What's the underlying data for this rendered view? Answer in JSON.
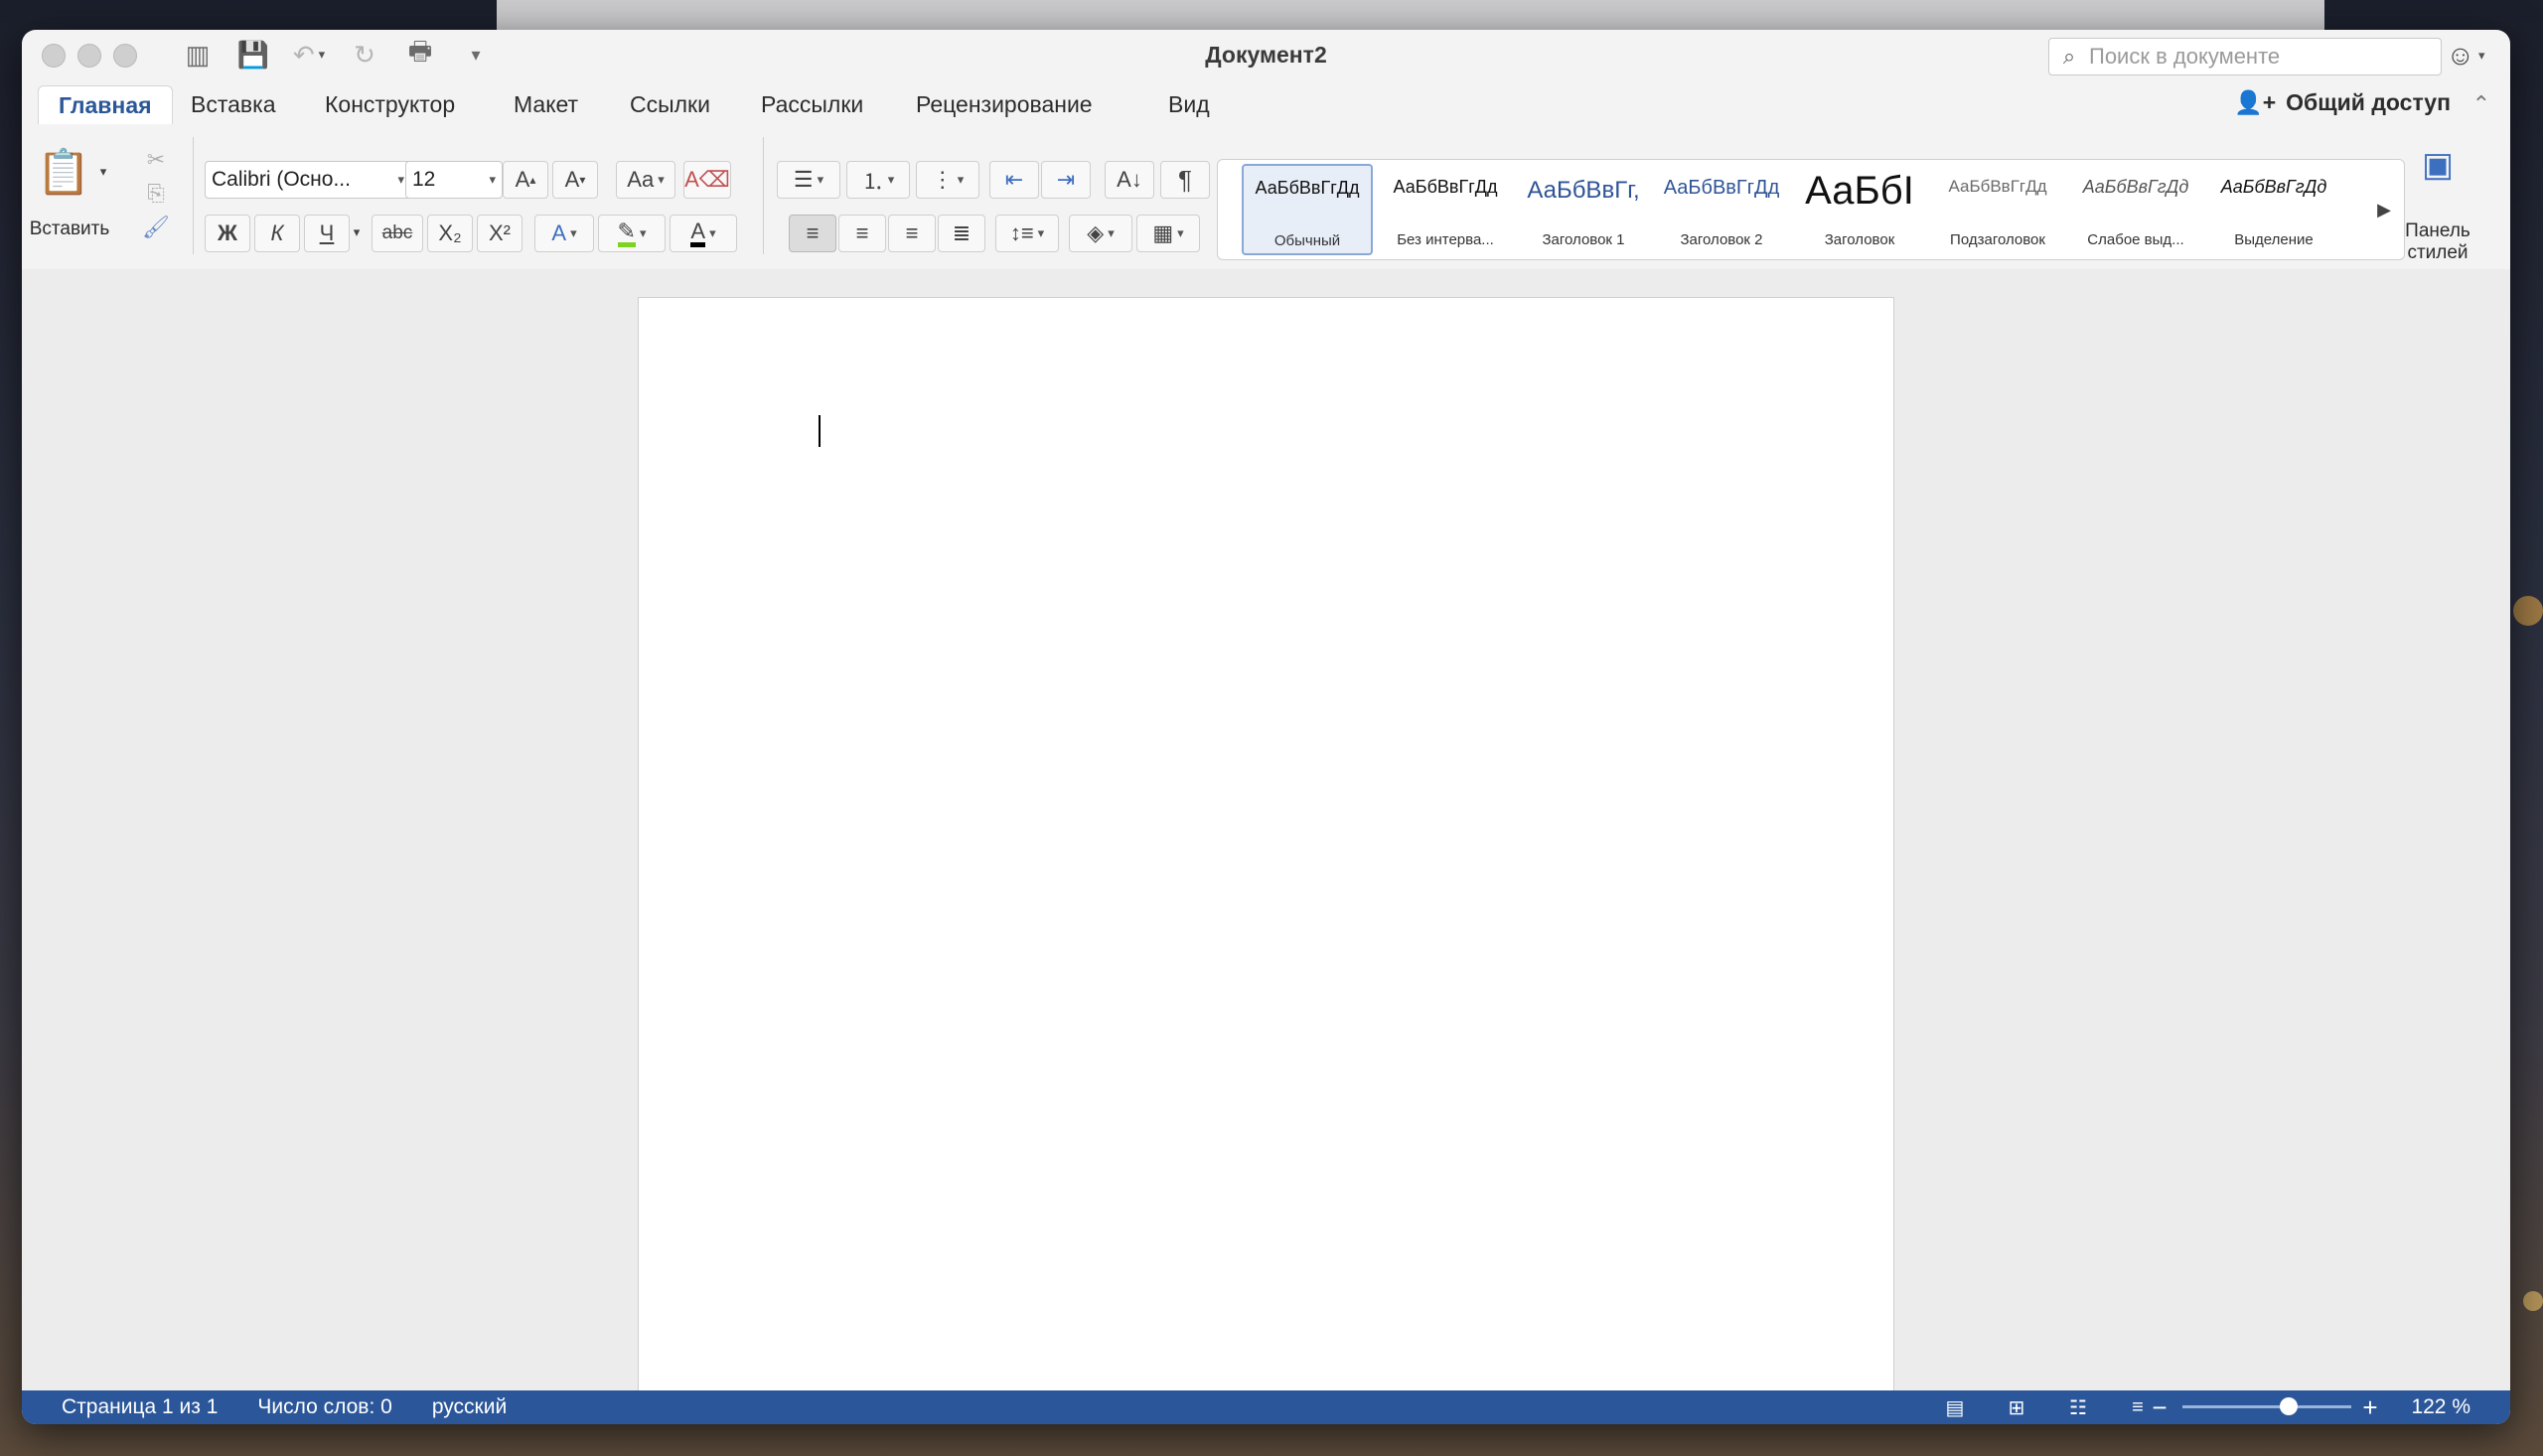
{
  "window": {
    "title": "Документ2"
  },
  "search": {
    "placeholder": "Поиск в документе"
  },
  "tabs": [
    {
      "label": "Главная",
      "active": true
    },
    {
      "label": "Вставка"
    },
    {
      "label": "Конструктор"
    },
    {
      "label": "Макет"
    },
    {
      "label": "Ссылки"
    },
    {
      "label": "Рассылки"
    },
    {
      "label": "Рецензирование"
    },
    {
      "label": "Вид"
    }
  ],
  "share": {
    "label": "Общий доступ"
  },
  "clipboard": {
    "paste_label": "Вставить"
  },
  "font": {
    "name": "Calibri (Осно...",
    "size": "12"
  },
  "format": {
    "bold": "Ж",
    "italic": "К",
    "underline": "Ч",
    "strike": "abc",
    "subscript": "X₂",
    "superscript": "X²",
    "font_color": "A",
    "highlight_color": "#7ed321",
    "font_color_value": "#000000"
  },
  "paragraph": {
    "pilcrow": "¶"
  },
  "styles": [
    {
      "preview": "АаБбВвГгДд",
      "label": "Обычный",
      "selected": true
    },
    {
      "preview": "АаБбВвГгДд",
      "label": "Без интерва..."
    },
    {
      "preview": "АаБбВвГг,",
      "label": "Заголовок 1"
    },
    {
      "preview": "АаБбВвГгДд",
      "label": "Заголовок 2"
    },
    {
      "preview": "АаБбI",
      "label": "Заголовок"
    },
    {
      "preview": "АаБбВвГгДд",
      "label": "Подзаголовок"
    },
    {
      "preview": "АаБбВвГгДд",
      "label": "Слабое выд..."
    },
    {
      "preview": "АаБбВвГгДд",
      "label": "Выделение"
    }
  ],
  "styles_pane": {
    "label_line1": "Панель",
    "label_line2": "стилей"
  },
  "status": {
    "page": "Страница 1 из 1",
    "words": "Число слов: 0",
    "language": "русский",
    "zoom": "122 %",
    "zoom_level_fraction": 0.63
  },
  "colors": {
    "accent": "#2b579a"
  }
}
